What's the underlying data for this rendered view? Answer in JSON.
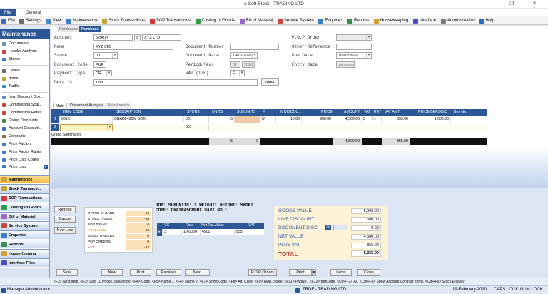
{
  "window": {
    "title": "e-Soft Stock - TRADING LTD",
    "controls": "— ❐ ✕"
  },
  "ribbon_tabs": [
    "File",
    "General"
  ],
  "toolbar": [
    {
      "label": "File",
      "color": "#3b6fb6"
    },
    {
      "label": "Settings",
      "color": "#6a6a6a"
    },
    {
      "label": "View",
      "color": "#4a8ad4"
    },
    {
      "label": "Maintenance",
      "color": "#3d7ad0"
    },
    {
      "label": "Stock Transactions",
      "color": "#c8a43a"
    },
    {
      "label": "SOP Transactions",
      "color": "#d03a3a"
    },
    {
      "label": "Costing of Goods",
      "color": "#2f9c4a"
    },
    {
      "label": "Bill of Material",
      "color": "#9a6ac8"
    },
    {
      "label": "Service System",
      "color": "#c84a3a"
    },
    {
      "label": "Enquiries",
      "color": "#3a7ac8"
    },
    {
      "label": "Reports",
      "color": "#3a8a4a"
    },
    {
      "label": "HouseKeeping",
      "color": "#d0a030"
    },
    {
      "label": "Interface",
      "color": "#4a4ac8"
    },
    {
      "label": "Administration",
      "color": "#7a7a7a"
    },
    {
      "label": "Help",
      "color": "#2a6ac8"
    }
  ],
  "sidebar": {
    "title": "Maintenance",
    "items": [
      {
        "label": "Documents",
        "color": "#6b8fc4"
      },
      {
        "label": "Header Analysis",
        "color": "#c84040"
      },
      {
        "label": "Stores",
        "color": "#3a7ac8"
      },
      {
        "label": "Levels",
        "color": "#6a6a6a"
      },
      {
        "label": "Items",
        "color": "#c8a43a"
      },
      {
        "label": "Tariffs",
        "color": "#3a8ac8"
      },
      {
        "label": "Item Discount Gro...",
        "color": "#6a8ac8"
      },
      {
        "label": "Commission Scal...",
        "color": "#c84040"
      },
      {
        "label": "Commission Rates",
        "color": "#c84040"
      },
      {
        "label": "Group Discounts",
        "color": "#4a8a4a"
      },
      {
        "label": "Account Discount...",
        "color": "#3a6ac8"
      },
      {
        "label": "Contracts",
        "color": "#8a6a3a"
      },
      {
        "label": "Price Factors",
        "color": "#3a7ac8"
      },
      {
        "label": "Price Factor Rates",
        "color": "#3a7ac8"
      },
      {
        "label": "Price Lists Codes",
        "color": "#3a7ac8"
      },
      {
        "label": "Price Lists",
        "color": "#3a7ac8"
      }
    ],
    "groups": [
      {
        "label": "Maintenance",
        "color": "#c8a43a"
      },
      {
        "label": "Stock Transacti...",
        "color": "#c8a43a"
      },
      {
        "label": "SOP Transactions",
        "color": "#d03a3a"
      },
      {
        "label": "Costing of Goods",
        "color": "#2f9c4a"
      },
      {
        "label": "Bill of Material",
        "color": "#9a6ac8"
      },
      {
        "label": "Service System",
        "color": "#c84a3a"
      },
      {
        "label": "Enquiries",
        "color": "#3a7ac8"
      },
      {
        "label": "Reports",
        "color": "#3a8a4a"
      },
      {
        "label": "HouseKeeping",
        "color": "#d0a030"
      },
      {
        "label": "Interface Files",
        "color": "#4a4ac8"
      }
    ]
  },
  "form": {
    "tabs": [
      "Purchases",
      "Purchase"
    ],
    "account_label": "Account",
    "account_code": "320014",
    "account_name": "XYZ LTD",
    "name_label": "Name",
    "name": "XYZ LTD",
    "store_label": "Store",
    "store": "001",
    "doc_code_label": "Document Code",
    "doc_code": "PUR",
    "payment_type_label": "Payment Type",
    "payment_type": "CR",
    "details_label": "Details",
    "details": "Test",
    "doc_number_label": "Document Number",
    "doc_number": "",
    "doc_date_label": "Document Date",
    "doc_date": "19/02/2020",
    "period_year_label": "Period/Year",
    "period": "02",
    "year": "2020",
    "vat_label": "VAT (I/E)",
    "vat": "E",
    "pop_order_label": "P.O.P Order",
    "pop_order": "",
    "other_ref_label": "Other Reference",
    "other_ref": "",
    "due_date_label": "Due Date",
    "due_date": "19/02/2020",
    "entry_date_label": "Entry Date",
    "entry_date": "19/02/2020",
    "import_label": "Import"
  },
  "grid": {
    "tabs": [
      "Main",
      "Document Analysis",
      "Attachments"
    ],
    "columns": [
      "ITEM CODE",
      "DESCRIPTION",
      "STORE",
      "UNITS",
      "SUBUNITS",
      "P",
      "% DISCOU...",
      "PRICE",
      "AMOUNT",
      "VAT",
      "RAT",
      "VAT AMT.",
      "PRICE BEF.DISC",
      "Box No."
    ],
    "row1": {
      "marker": "1",
      "item_code": "001K",
      "description": "CHAIN 45CM BOX",
      "store": "001",
      "units": "5",
      "subunits": "",
      "p": "U",
      "discount": "10.00",
      "price": "900.00",
      "amount": "4,500.00",
      "vat": "3",
      "rat": "15",
      "vat_amt": "855.00",
      "price_bef": "1,000.00"
    },
    "row2": {
      "marker": "2",
      "store": "001"
    },
    "summary_label": "Grand Summaries",
    "totals": {
      "units": "5",
      "subunits": "0",
      "amount": "4,500.00",
      "vat_amt": "855.00"
    }
  },
  "left_buttons": [
    "Refresh",
    "Cancel",
    "New Line"
  ],
  "stock_info": [
    {
      "label": "STOCK IN HAND",
      "value": "-12",
      "color": "#000000"
    },
    {
      "label": "STOCK TRANS.",
      "value": "-10",
      "color": "#000000"
    },
    {
      "label": "SOP TRANS",
      "value": "0",
      "color": "#000000"
    },
    {
      "label": "AVAILABLE",
      "value": "-22",
      "color": "#d08a20"
    },
    {
      "label": "SALES ORDERS",
      "value": "0",
      "color": "#000000"
    },
    {
      "label": "POP ORDERS",
      "value": "0",
      "color": "#000000"
    },
    {
      "label": "NET",
      "value": "-22",
      "color": "#d03a3a"
    }
  ],
  "uom": {
    "line1": "UOM:   SUBUNITS: 1 WEIGHT:  HEIGHT:  SHORT",
    "line2": "CODE: CHAIN45CMBOX PART NO.:",
    "vat_columns": [
      "VC",
      "Rate",
      "Net Tax.Value",
      "VAT"
    ],
    "vat_row": {
      "vc": "3",
      "rate": "19.0000",
      "net": "4500",
      "vat": "855"
    }
  },
  "totals": {
    "goods_value_label": "GOODS VALUE",
    "goods_value": "5,000.00",
    "line_discount_label": "LINE DISCOUNT",
    "line_discount": "500.00",
    "doc_disc_label": "DOCUMENT DISC.",
    "doc_disc_pct": "%",
    "doc_disc": "0.00",
    "net_value_label": "NET VALUE",
    "net_value": "4,500.00",
    "plus_vat_label": "PLUS VAT",
    "plus_vat": "855.00",
    "total_label": "TOTAL",
    "total": "5,355.00"
  },
  "actions": [
    "Save",
    "New",
    "Post",
    "Previous",
    "Next",
    "P.O.P Orders",
    "Print",
    "Items",
    "Close"
  ],
  "hint": "<F2> Next Item, <F3> Last 10 Prices, Search by: <F4> Code, <F5> Name 1, <F6> Name 2, <F7> Short Code, <F8> Alt. Code, <F9> Avail. Stock, <F11> PartNo., <F12> BarCode, <Ctrl+F2> All, <Ctrl+F3> Show Account Contract Items, <Ctrl+F5> Stock Enquiry",
  "status": {
    "user": "Manager Administrator",
    "company": "TRDE - TRADING LTD",
    "date": "19-February-2020",
    "caps": "CAPS LOCK",
    "num": "NUM LOCK"
  }
}
